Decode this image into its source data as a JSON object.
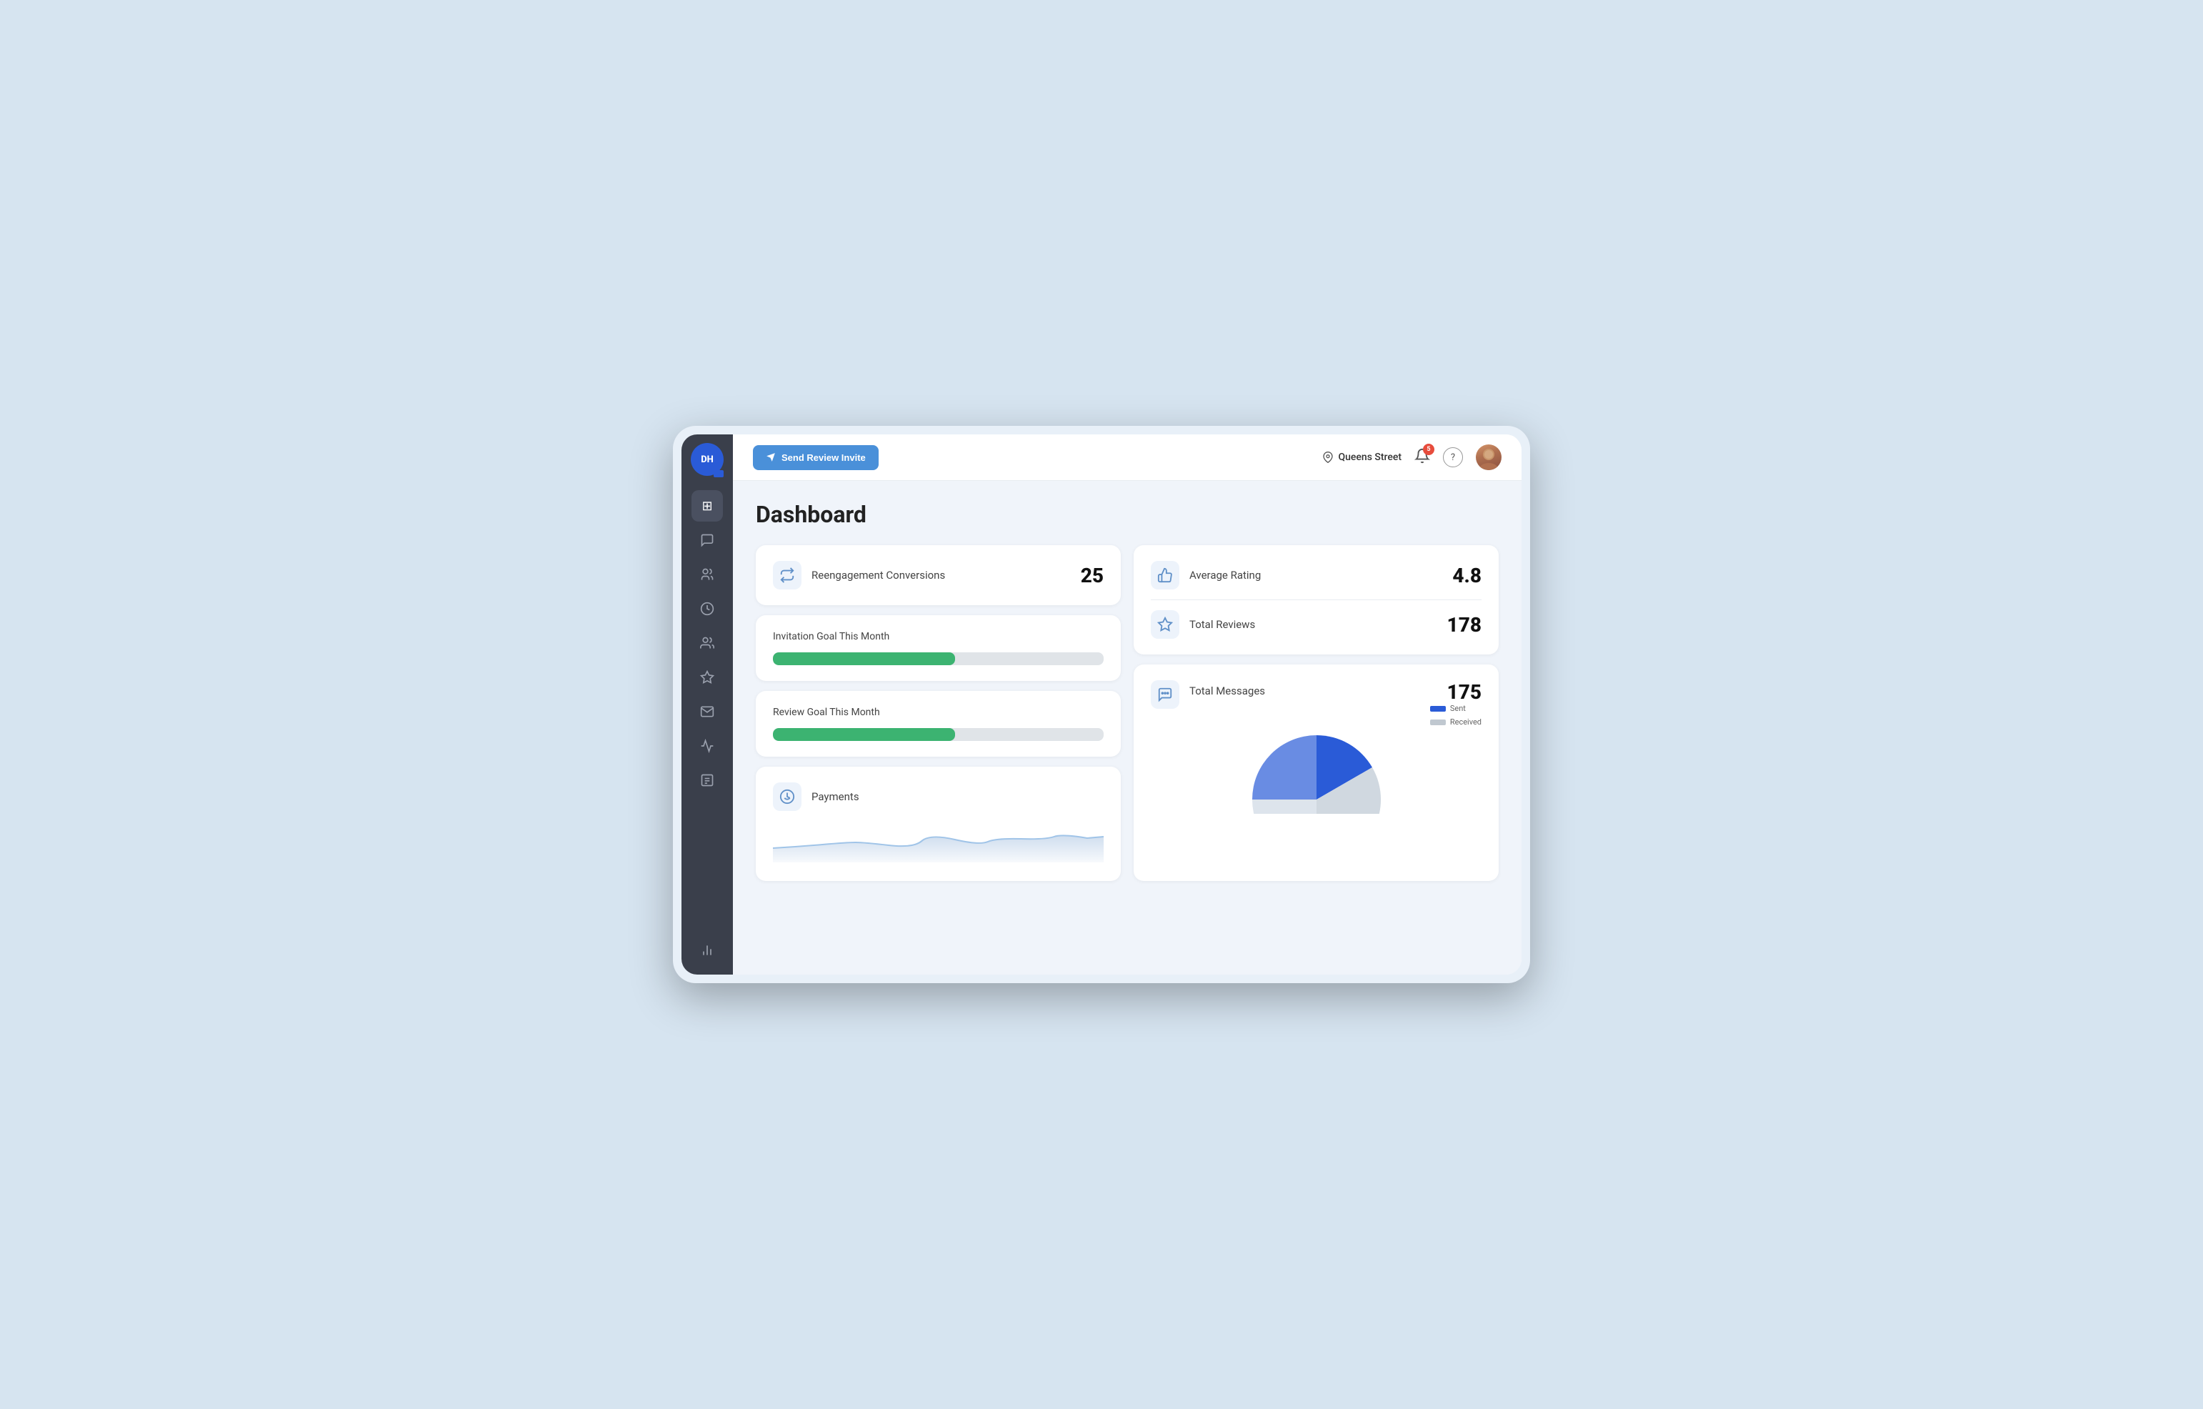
{
  "sidebar": {
    "logo_text": "DH",
    "items": [
      {
        "id": "dashboard",
        "icon": "⊞",
        "active": true
      },
      {
        "id": "messages",
        "icon": "💬",
        "active": false
      },
      {
        "id": "contacts",
        "icon": "👥",
        "active": false
      },
      {
        "id": "history",
        "icon": "🕐",
        "active": false
      },
      {
        "id": "team",
        "icon": "👤",
        "active": false
      },
      {
        "id": "reviews",
        "icon": "☆",
        "active": false
      },
      {
        "id": "email",
        "icon": "✉",
        "active": false
      },
      {
        "id": "analytics",
        "icon": "〜",
        "active": false
      },
      {
        "id": "documents",
        "icon": "📋",
        "active": false
      }
    ],
    "bottom_item": {
      "id": "stats",
      "icon": "📊"
    }
  },
  "header": {
    "send_invite_button": "Send Review Invite",
    "location": "Queens Street",
    "notification_count": "5",
    "help_label": "?"
  },
  "page": {
    "title": "Dashboard"
  },
  "cards": {
    "reengagement": {
      "label": "Reengagement Conversions",
      "value": "25"
    },
    "invitation_goal": {
      "title": "Invitation Goal This Month",
      "progress": 55
    },
    "review_goal": {
      "title": "Review Goal This Month",
      "progress": 55
    },
    "payments": {
      "label": "Payments"
    },
    "average_rating": {
      "label": "Average Rating",
      "value": "4.8"
    },
    "total_reviews": {
      "label": "Total Reviews",
      "value": "178"
    },
    "total_messages": {
      "label": "Total Messages",
      "value": "175",
      "legend_sent": "Sent",
      "legend_received": "Received",
      "sent_color": "#2a5bd7",
      "received_color": "#c0c8d0"
    }
  }
}
